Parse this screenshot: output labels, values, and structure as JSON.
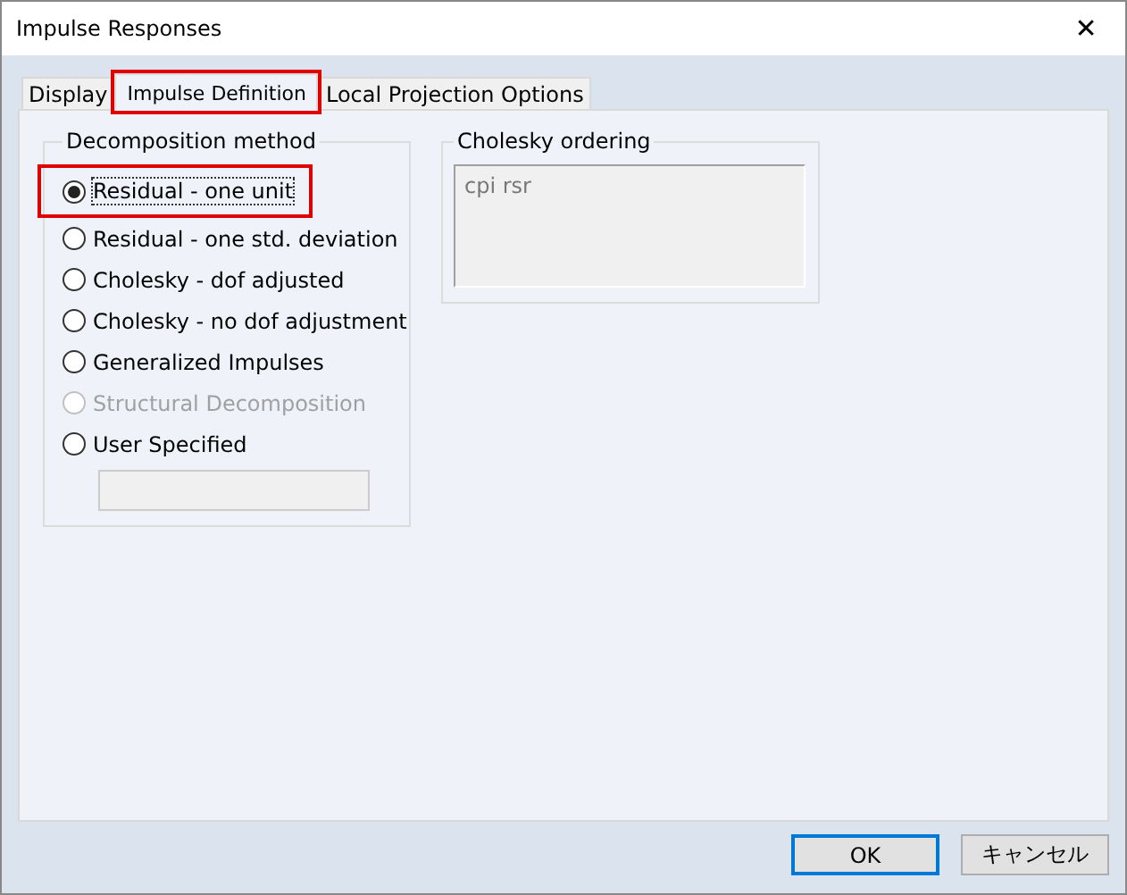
{
  "window": {
    "title": "Impulse Responses",
    "close": "✕"
  },
  "tabs": [
    {
      "label": "Display",
      "selected": false,
      "highlighted": false
    },
    {
      "label": "Impulse Definition",
      "selected": true,
      "highlighted": true
    },
    {
      "label": "Local Projection Options",
      "selected": false,
      "highlighted": false
    }
  ],
  "decomposition": {
    "title": "Decomposition method",
    "options": [
      {
        "label": "Residual - one unit",
        "selected": true,
        "disabled": false,
        "highlighted": true,
        "focused": true
      },
      {
        "label": "Residual - one std. deviation",
        "selected": false,
        "disabled": false,
        "highlighted": false,
        "focused": false
      },
      {
        "label": "Cholesky - dof adjusted",
        "selected": false,
        "disabled": false,
        "highlighted": false,
        "focused": false
      },
      {
        "label": "Cholesky - no dof adjustment",
        "selected": false,
        "disabled": false,
        "highlighted": false,
        "focused": false
      },
      {
        "label": "Generalized Impulses",
        "selected": false,
        "disabled": false,
        "highlighted": false,
        "focused": false
      },
      {
        "label": "Structural Decomposition",
        "selected": false,
        "disabled": true,
        "highlighted": false,
        "focused": false
      },
      {
        "label": "User Specified",
        "selected": false,
        "disabled": false,
        "highlighted": false,
        "focused": false
      }
    ]
  },
  "cholesky": {
    "title": "Cholesky ordering",
    "value": "cpi rsr"
  },
  "buttons": [
    {
      "label": "OK",
      "default": true
    },
    {
      "label": "キャンセル",
      "default": false
    }
  ]
}
